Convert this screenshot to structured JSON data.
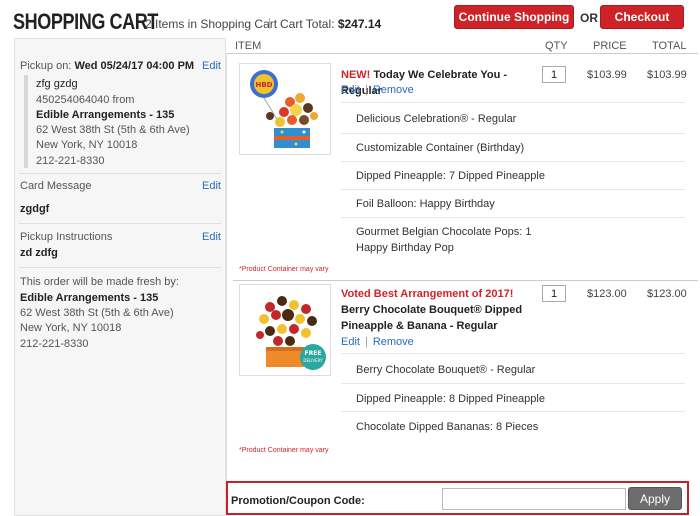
{
  "header": {
    "title": "SHOPPING CART",
    "items_count": "2 Items in Shopping Cart",
    "cart_total_label": "Cart Total:",
    "cart_total_value": "$247.14",
    "continue_label": "Continue Shopping",
    "or_label": "OR",
    "checkout_label": "Checkout"
  },
  "colors": {
    "brand_red": "#cc2228",
    "link_blue": "#2a6cb6",
    "apply_gray": "#6d6d6d"
  },
  "left": {
    "pickup_label": "Pickup on:",
    "pickup_value": "Wed 05/24/17 04:00 PM",
    "edit": "Edit",
    "recipient": "zfg gzdg",
    "phone_from": "450254064040 from",
    "store_name": "Edible Arrangements - 135",
    "addr1": "62 West 38th St (5th & 6th Ave)",
    "addr2": "New York, NY 10018",
    "store_phone": "212-221-8330",
    "card_label": "Card Message",
    "card_value": "zgdgf",
    "instr_label": "Pickup Instructions",
    "instr_value": "zd zdfg",
    "fresh_label": "This order will be made fresh by:",
    "fresh_store": "Edible Arrangements - 135",
    "fresh_addr1": "62 West 38th St (5th & 6th Ave)",
    "fresh_addr2": "New York, NY 10018",
    "fresh_phone": "212-221-8330"
  },
  "table": {
    "col_item": "ITEM",
    "col_qty": "QTY",
    "col_price": "PRICE",
    "col_total": "TOTAL"
  },
  "items": [
    {
      "promo": "NEW!",
      "name": "Today We Celebrate You - Regular",
      "edit": "Edit",
      "sep": "|",
      "remove": "Remove",
      "qty": "1",
      "price": "$103.99",
      "total": "$103.99",
      "options": [
        "Delicious Celebration® - Regular",
        "Customizable Container (Birthday)",
        "Dipped Pineapple: 7 Dipped Pineapple",
        "Foil Balloon: Happy Birthday",
        "Gourmet Belgian Chocolate Pops: 1 Happy Birthday Pop"
      ],
      "note": "*Product Container may vary"
    },
    {
      "promo": "Voted Best Arrangement of 2017!",
      "name": "Berry Chocolate Bouquet® Dipped Pineapple & Banana - Regular",
      "edit": "Edit",
      "sep": "|",
      "remove": "Remove",
      "qty": "1",
      "price": "$123.00",
      "total": "$123.00",
      "options": [
        "Berry Chocolate Bouquet® - Regular",
        "Dipped Pineapple: 8 Dipped Pineapple",
        "Chocolate Dipped Bananas: 8 Pieces"
      ],
      "note": "*Product Container may vary",
      "badge": "FREE DELIVERY"
    }
  ],
  "promo": {
    "label": "Promotion/Coupon Code:",
    "value": "",
    "apply": "Apply"
  }
}
